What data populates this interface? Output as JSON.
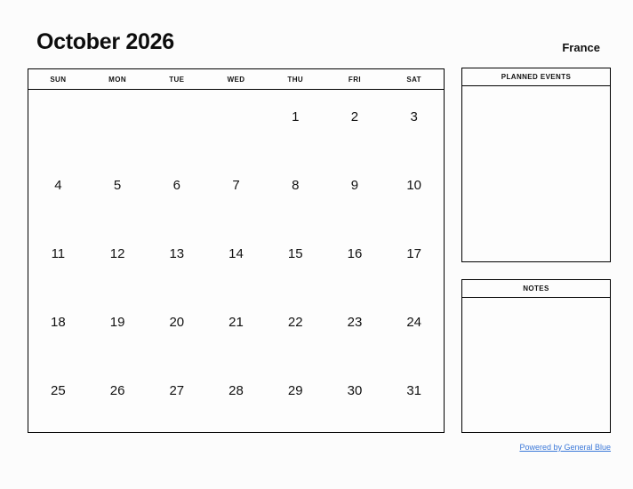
{
  "header": {
    "title": "October 2026",
    "region": "France"
  },
  "calendar": {
    "weekdays": [
      "SUN",
      "MON",
      "TUE",
      "WED",
      "THU",
      "FRI",
      "SAT"
    ],
    "weeks": [
      [
        "",
        "",
        "",
        "",
        "1",
        "2",
        "3"
      ],
      [
        "4",
        "5",
        "6",
        "7",
        "8",
        "9",
        "10"
      ],
      [
        "11",
        "12",
        "13",
        "14",
        "15",
        "16",
        "17"
      ],
      [
        "18",
        "19",
        "20",
        "21",
        "22",
        "23",
        "24"
      ],
      [
        "25",
        "26",
        "27",
        "28",
        "29",
        "30",
        "31"
      ]
    ]
  },
  "panels": {
    "planned_events": {
      "title": "PLANNED EVENTS",
      "body": ""
    },
    "notes": {
      "title": "NOTES",
      "body": ""
    }
  },
  "footer": {
    "link_text": "Powered by General Blue"
  },
  "colors": {
    "link": "#3b78d8",
    "border": "#000000",
    "text": "#111111",
    "background": "#fcfcfc"
  }
}
